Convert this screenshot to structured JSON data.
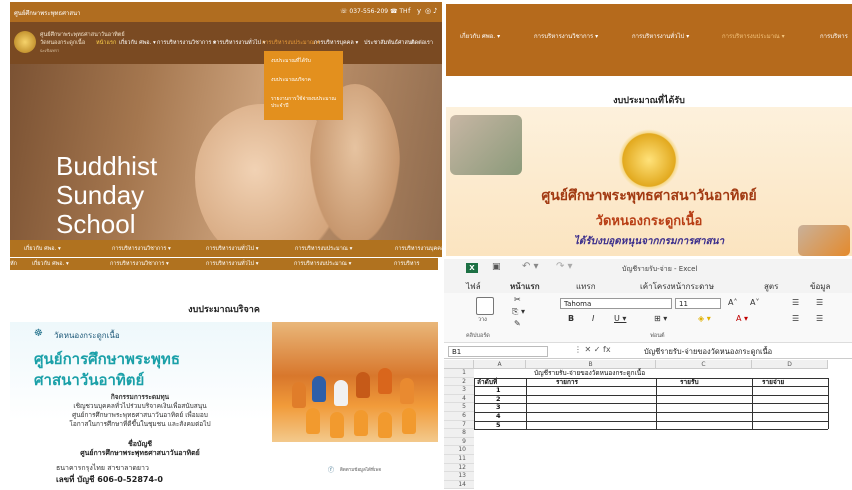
{
  "panel1": {
    "site_name": "ศูนย์ศึกษาพระพุทธศาสนา",
    "phone": "☏ 037-556-209 ☎ TH",
    "social": [
      "f",
      "y",
      "◎",
      "♪"
    ],
    "logo": {
      "line1": "ศูนย์ศึกษาพระพุทธศาสนาวันอาทิตย์",
      "line2": "วัดหนองกระดูกเนื้อ",
      "line3": "ฉะเชิงเทรา"
    },
    "menu": [
      {
        "label": "หน้าแรก",
        "active": true
      },
      {
        "label": "เกี่ยวกับ ศพอ. ▾",
        "active": false
      },
      {
        "label": "การบริหารงานวิชาการ ▾",
        "active": false
      },
      {
        "label": "การบริหารงานทั่วไป ▾",
        "active": false
      },
      {
        "label": "การบริหารงบประมาณ ▾",
        "active": false
      },
      {
        "label": "การบริหารบุคคล ▾",
        "active": false
      },
      {
        "label": "ประชาสัมพันธ์ศาสนา",
        "active": false
      },
      {
        "label": "ติดต่อเรา",
        "active": false
      }
    ],
    "dropdown_items": [
      "งบประมาณที่ได้รับ",
      "งบประมาณบริจาค",
      "รายงานการใช้จ่ายงบประมาณประจำปี"
    ],
    "hero_lines": [
      "Buddhist",
      "Sunday",
      "School"
    ],
    "subnav": [
      "เกี่ยวกับ ศพอ. ▾",
      "การบริหารงานวิชาการ ▾",
      "การบริหารงานทั่วไป ▾",
      "การบริหารงบประมาณ ▾",
      "การบริหารงานบุคคล"
    ]
  },
  "panel2": {
    "nav": [
      "เกี่ยวกับ ศพอ. ▾",
      "การบริหารงานวิชาการ ▾",
      "การบริหารงานทั่วไป ▾",
      "การบริหารงบประมาณ ▾",
      "การบริหาร"
    ],
    "title": "งบประมาณที่ได้รับ",
    "banner": {
      "line1": "ศูนย์ศึกษาพระพุทธศาสนาวันอาทิตย์",
      "line2": "วัดหนองกระดูกเนื้อ",
      "line3": "ได้รับงบอุดหนุนจากกรมการศาสนา"
    }
  },
  "panel3": {
    "subnav": [
      "หัก",
      "เกี่ยวกับ ศพอ. ▾",
      "การบริหารงานวิชาการ ▾",
      "การบริหารงานทั่วไป ▾",
      "การบริหารงบประมาณ ▾",
      "การบริหาร"
    ],
    "title": "งบประมาณบริจาค",
    "poster": {
      "temple": "วัดหนองกระดูกเนื้อ",
      "heading1": "ศูนย์การศึกษาพระพุทธ",
      "heading2": "ศาสนาวันอาทิตย์",
      "lines": [
        "กิจกรรมการระดมทุน",
        "เชิญชวนบุคคลทั่วไปร่วมบริจาคเงินเพื่อสนับสนุน",
        "ศูนย์การศึกษาพระพุทธศาสนาวันอาทิตย์ เพื่อมอบ",
        "โอกาสในการศึกษาที่ดีขึ้นในชุมชน และสังคมต่อไป"
      ],
      "account_label": "ชื่อบัญชี",
      "account_name": "ศูนย์การศึกษาพระพุทธศาสนาวันอาทิตย์",
      "bank": "ธนาคารกรุงไทย สาขาลาดยาว",
      "account_no": "เลขที่ บัญชี 606-0-52874-0",
      "info": "ติดตามข้อมูลได้ที่เพจ"
    }
  },
  "excel": {
    "filename": "บัญชีรายรับ-จ่าย - Excel",
    "tabs": [
      "ไฟล์",
      "หน้าแรก",
      "แทรก",
      "เค้าโครงหน้ากระดาษ",
      "สูตร",
      "ข้อมูล"
    ],
    "active_tab": "หน้าแรก",
    "font_name": "Tahoma",
    "font_size": "11",
    "paste_label": "วาง",
    "group_labels": [
      "คลิปบอร์ด",
      "ฟอนต์"
    ],
    "namebox": "B1",
    "formula": "บัญชีรายรับ-จ่ายของวัดหนองกระดูกเนื้อ",
    "columns": [
      "A",
      "B",
      "C",
      "D"
    ],
    "rows": [
      "1",
      "2",
      "3",
      "4",
      "5",
      "6",
      "7",
      "8",
      "9",
      "10",
      "11",
      "12",
      "13",
      "14"
    ],
    "title_cell": "บัญชีรายรับ-จ่ายของวัดหนองกระดูกเนื้อ",
    "headers": [
      "ลำดับที่",
      "รายการ",
      "รายรับ",
      "รายจ่าย"
    ],
    "seq": [
      "1",
      "2",
      "3",
      "4",
      "5"
    ]
  }
}
